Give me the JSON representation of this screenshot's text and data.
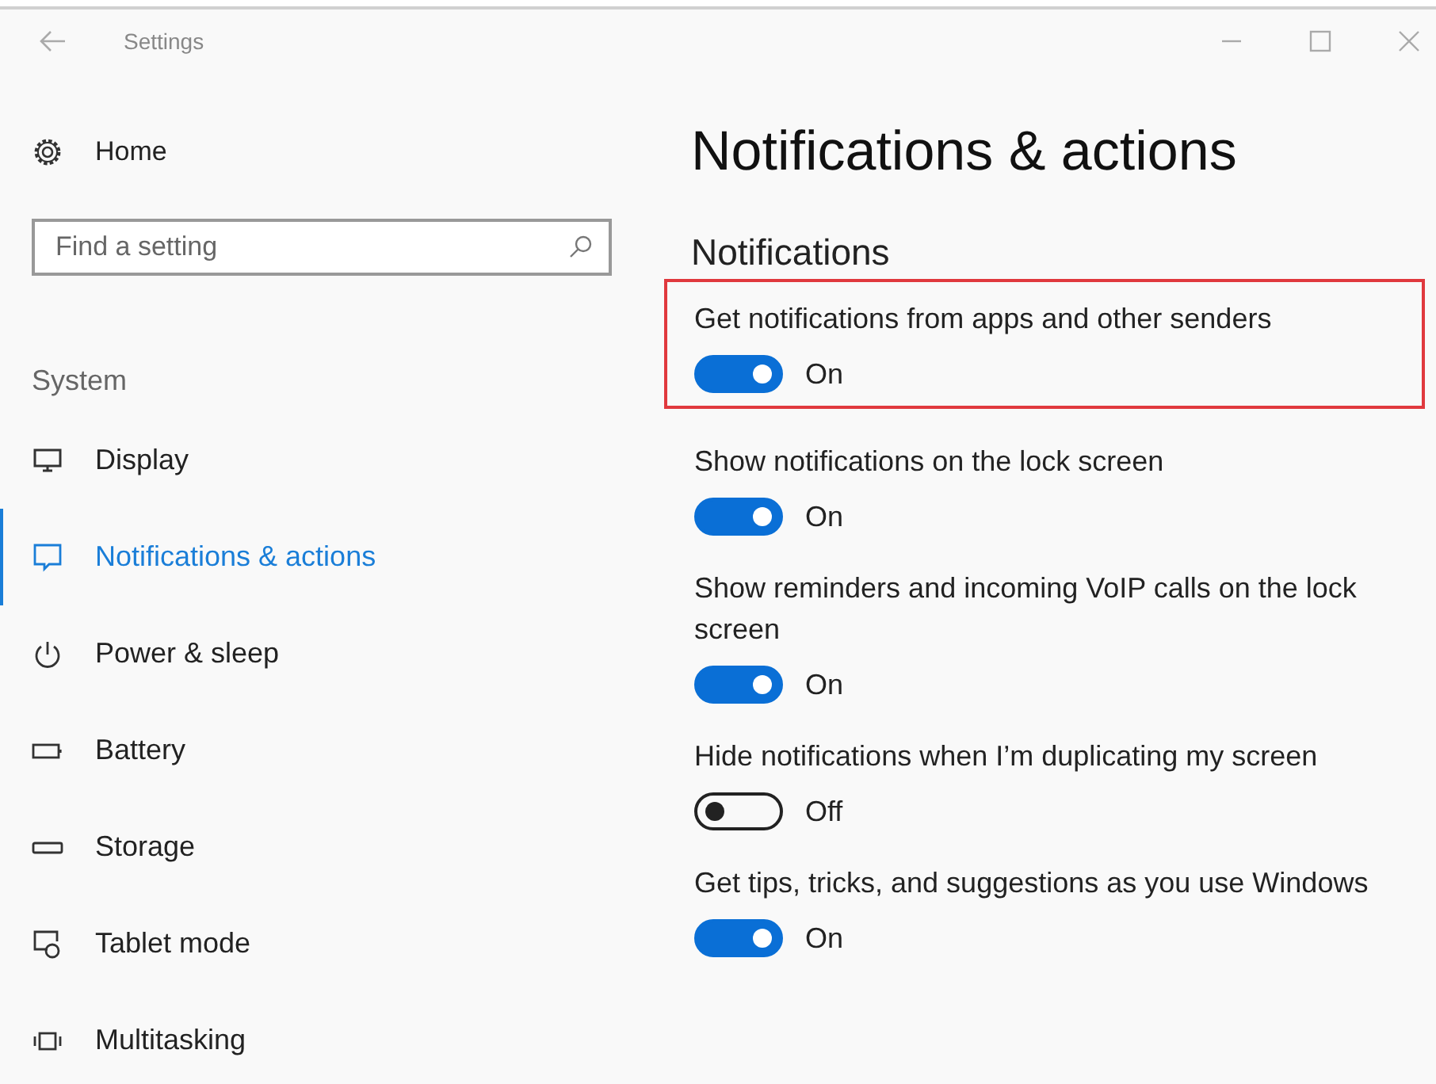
{
  "window": {
    "title": "Settings"
  },
  "sidebar": {
    "home": "Home",
    "search": {
      "placeholder": "Find a setting"
    },
    "section": "System",
    "items": [
      {
        "label": "Display",
        "kind": "display",
        "selected": false
      },
      {
        "label": "Notifications & actions",
        "kind": "notifications",
        "selected": true
      },
      {
        "label": "Power & sleep",
        "kind": "power",
        "selected": false
      },
      {
        "label": "Battery",
        "kind": "battery",
        "selected": false
      },
      {
        "label": "Storage",
        "kind": "storage",
        "selected": false
      },
      {
        "label": "Tablet mode",
        "kind": "tablet",
        "selected": false
      },
      {
        "label": "Multitasking",
        "kind": "multitasking",
        "selected": false
      }
    ]
  },
  "page": {
    "title": "Notifications & actions",
    "section": "Notifications",
    "settings": [
      {
        "label": "Get notifications from apps and other senders",
        "on": true,
        "state": "On",
        "highlighted": true
      },
      {
        "label": "Show notifications on the lock screen",
        "on": true,
        "state": "On",
        "highlighted": false
      },
      {
        "label": "Show reminders and incoming VoIP calls on the lock screen",
        "on": true,
        "state": "On",
        "highlighted": false
      },
      {
        "label": "Hide notifications when I’m duplicating my screen",
        "on": false,
        "state": "Off",
        "highlighted": false
      },
      {
        "label": "Get tips, tricks, and suggestions as you use Windows",
        "on": true,
        "state": "On",
        "highlighted": false
      }
    ]
  }
}
